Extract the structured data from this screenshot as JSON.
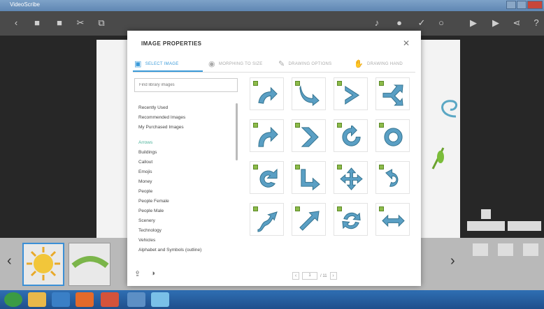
{
  "window": {
    "title": "VideoScribe"
  },
  "modal": {
    "title": "IMAGE PROPERTIES",
    "close_icon": "close-icon",
    "tabs": [
      {
        "label": "SELECT IMAGE",
        "icon": "image-icon",
        "active": true
      },
      {
        "label": "MORPHING TO SIZE",
        "icon": "eye-icon"
      },
      {
        "label": "DRAWING OPTIONS",
        "icon": "pencil-icon"
      },
      {
        "label": "DRAWING HAND",
        "icon": "hand-icon"
      }
    ],
    "search_placeholder": "Find library images",
    "sidebar": {
      "top": [
        "Recently Used",
        "Recommended Images",
        "My Purchased Images"
      ],
      "categories": [
        "Arrows",
        "Buildings",
        "Callout",
        "Emojis",
        "Money",
        "People",
        "People Female",
        "People Male",
        "Scenery",
        "Technology",
        "Vehicles",
        "Alphabet and Symbols (outline)"
      ],
      "active_category": "Arrows"
    },
    "grid_icons": [
      "curved-up-arrow",
      "curved-down-arrow",
      "chevron-right",
      "split-arrow",
      "curve-right-arrow",
      "chevron-thick-right",
      "rotate-arrow",
      "circle-ring",
      "u-turn-left",
      "elbow-down-right-arrow",
      "move-cross-arrows",
      "u-turn-right",
      "s-curve-arrow",
      "diagonal-up-arrow",
      "cycle-arrows",
      "double-horizontal-arrow"
    ],
    "pager": {
      "current": "1",
      "total": "/ 11"
    }
  },
  "colors": {
    "accent": "#3a9ad9",
    "arrow_fill": "#5a9fc4",
    "arrow_stroke": "#34738f",
    "category_active": "#4bb39a"
  }
}
